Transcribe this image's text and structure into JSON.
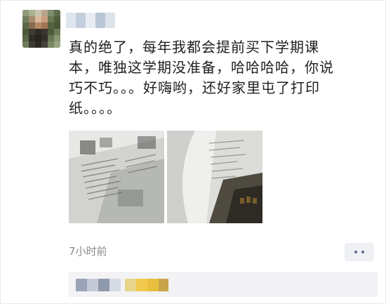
{
  "post": {
    "text": "真的绝了，每年我都会提前买下学期课\n本，唯独这学期没准备，哈哈哈哈，你说\n巧不巧。。。好嗨哟，还好家里屯了打印\n纸。。。。",
    "time": "7小时前",
    "images": [
      {
        "name": "photo-printed-pages-1"
      },
      {
        "name": "photo-printed-pages-2"
      }
    ]
  },
  "icons": {
    "more": "more-dots-icon"
  },
  "colors": {
    "accent_link": "#5b6b8e",
    "timestamp": "#8a8a8a",
    "bar_background": "#f3f3f5"
  }
}
